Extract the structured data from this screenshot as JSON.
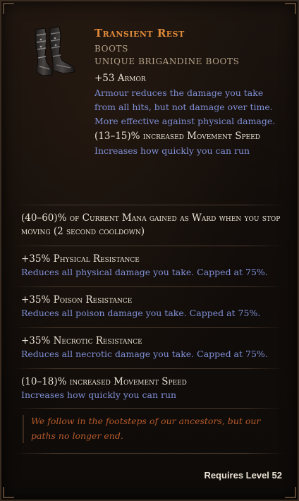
{
  "item": {
    "name": "Transient Rest",
    "type": "Boots",
    "subtype": "Unique Brigandine Boots",
    "implicits": [
      {
        "stat": "+53 Armor",
        "description": "Armour reduces the damage you take from all hits, but not damage over time. More effective against physical damage."
      },
      {
        "stat": "(13–15)% increased Movement Speed",
        "description": "Increases how quickly you can run"
      }
    ],
    "affixes": [
      {
        "stat": "(40–60)% of Current Mana gained as Ward when you stop moving (2 second cooldown)",
        "description": ""
      },
      {
        "stat": "+35% Physical Resistance",
        "description": "Reduces all physical damage you take. Capped at 75%."
      },
      {
        "stat": "+35% Poison Resistance",
        "description": "Reduces all poison damage you take. Capped at 75%."
      },
      {
        "stat": "+35% Necrotic Resistance",
        "description": "Reduces all necrotic damage you take. Capped at 75%."
      },
      {
        "stat": "(10–18)% increased Movement Speed",
        "description": "Increases how quickly you can run"
      }
    ],
    "lore": "We follow in the footsteps of our ancestors, but our paths no longer end.",
    "requirement": "Requires Level 52",
    "icon": "boots-icon"
  },
  "colors": {
    "unique_name": "#e08a3a",
    "stat_text": "#e9e1d3",
    "description_text": "#7f8fd6",
    "lore_text": "#b65a2a",
    "type_text": "#b7a48a"
  }
}
